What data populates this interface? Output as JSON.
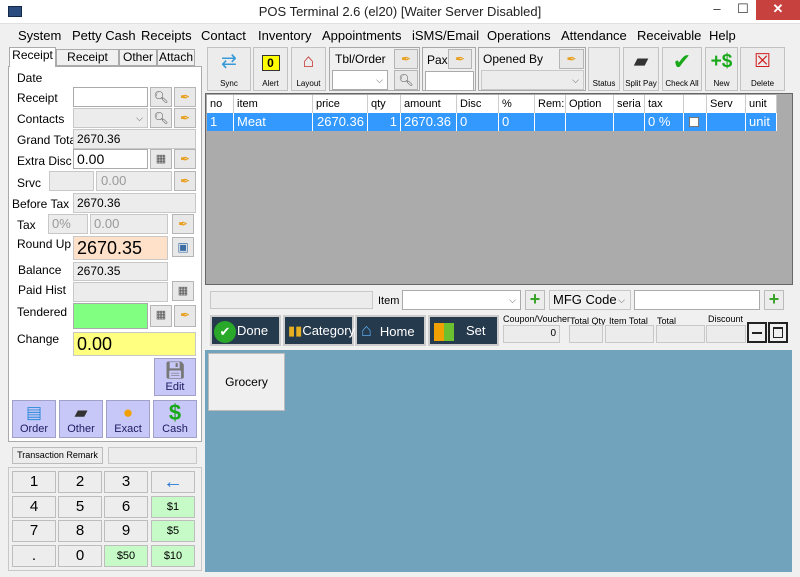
{
  "window": {
    "title": "POS Terminal 2.6 (el20) [Waiter Server Disabled]",
    "minimize": "–",
    "maximize": "☐",
    "close": "✕"
  },
  "menu": [
    "System",
    "Petty Cash",
    "Receipts",
    "Contact",
    "Inventory",
    "Appointments",
    "iSMS/Email",
    "Operations",
    "Attendance",
    "Receivable",
    "Help"
  ],
  "left_tabs": [
    "Receipt",
    "Receipt Info",
    "Other",
    "Attach"
  ],
  "receipt": {
    "date_label": "Date",
    "receipt_label": "Receipt",
    "receipt_value": "",
    "contacts_label": "Contacts",
    "contacts_value": "",
    "grand_total_label": "Grand Total",
    "grand_total": "2670.36",
    "extra_disc_label": "Extra Disc",
    "extra_disc": "0.00",
    "srvc_label": "Srvc",
    "srvc_value": "0.00",
    "before_tax_label": "Before Tax",
    "before_tax": "2670.36",
    "tax_label": "Tax",
    "tax_pct": "0%",
    "tax_value": "0.00",
    "round_up_label": "Round Up",
    "round_up": "2670.35",
    "balance_label": "Balance",
    "balance": "2670.35",
    "paid_hist_label": "Paid Hist",
    "paid_hist": "",
    "tendered_label": "Tendered",
    "tendered": "",
    "change_label": "Change",
    "change": "0.00",
    "edit_label": "Edit"
  },
  "pay_buttons": [
    {
      "label": "Order",
      "icon": "basket-icon"
    },
    {
      "label": "Other",
      "icon": "card-terminal-icon"
    },
    {
      "label": "Exact",
      "icon": "coin-icon"
    },
    {
      "label": "Cash",
      "icon": "dollar-icon"
    }
  ],
  "transaction_remark": {
    "label": "Transaction Remark",
    "value": ""
  },
  "keypad": [
    "1",
    "2",
    "3",
    "←",
    "4",
    "5",
    "6",
    "$1",
    "7",
    "8",
    "9",
    "$5",
    ".",
    "0",
    "$50",
    "$10"
  ],
  "toolbar": {
    "sync": "Sync",
    "alert": "Alert",
    "alert_count": "0",
    "layout": "Layout",
    "tbl_order": "Tbl/Order",
    "tbl_order_value": "",
    "pax": "Pax",
    "pax_value": "",
    "opened_by": "Opened By",
    "opened_by_value": "",
    "status": "Status",
    "split_pay": "Split Pay",
    "check_all": "Check All",
    "new": "New",
    "delete": "Delete"
  },
  "grid": {
    "columns": [
      "no",
      "item",
      "price",
      "qty",
      "amount",
      "Disc",
      "%",
      "Rem:",
      "Option",
      "seria",
      "tax",
      "",
      "Serv",
      "unit"
    ],
    "rows": [
      {
        "no": "1",
        "item": "Meat",
        "price": "2670.36",
        "qty": "1",
        "amount": "2670.36",
        "disc": "0",
        "pct": "0",
        "rem": "",
        "option": "",
        "serial": "",
        "tax": "0 %",
        "checked": false,
        "serv": "",
        "unit": "unit"
      }
    ]
  },
  "item_entry": {
    "status_text": "",
    "item_label": "Item",
    "item_value": "",
    "code_type": "MFG Code",
    "code_value": ""
  },
  "actions": [
    "Done",
    "Category",
    "Home",
    "Set"
  ],
  "summary": {
    "coupon_label": "Coupon/Voucher",
    "coupon_value": "0",
    "total_qty_label": "Total Qty",
    "total_qty": "",
    "item_total_label": "Item Total",
    "item_total": "",
    "total_label": "Total",
    "total": "",
    "discount_label": "Discount",
    "discount": ""
  },
  "categories": [
    "Grocery"
  ],
  "colors": {
    "selected_row": "#3399ff",
    "category_bg": "#71a3bc",
    "tendered": "#80ff80",
    "change": "#ffff80",
    "round_up": "#ffe0c8",
    "action_btn": "#263a4e"
  }
}
